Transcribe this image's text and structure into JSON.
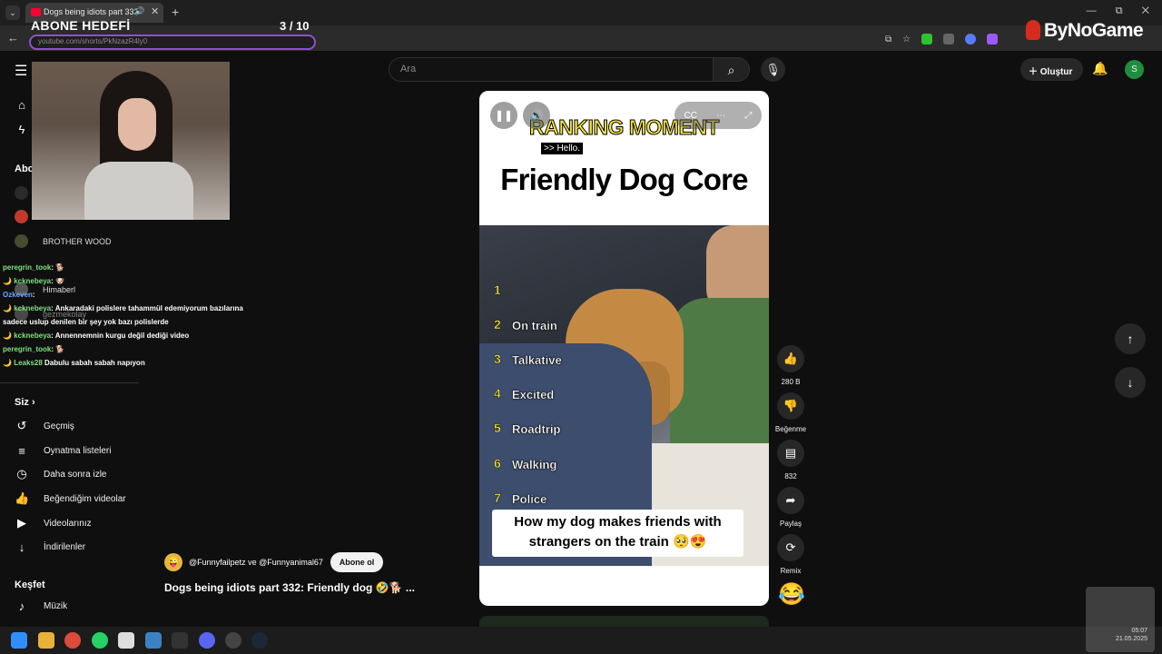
{
  "browser": {
    "tab_title": "Dogs being idiots part 332: Friendly dog",
    "url": "youtube.com/shorts/PkNzazR4ly0",
    "new_tab": "+",
    "tablist": "⌄",
    "back": "←",
    "window_controls": "— ⧉ ✕"
  },
  "stream_overlay": {
    "goal_label": "ABONE HEDEFİ",
    "goal_count": "3  / 10",
    "sponsor": "ByNoGame"
  },
  "header": {
    "search_placeholder": "Ara",
    "create_label": "Oluştur",
    "avatar_letter": "S"
  },
  "sidebar": {
    "subscriptions_heading": "Abo",
    "channels": [
      {
        "name": "BROTHER WOOD"
      },
      {
        "name": "Himaberl"
      },
      {
        "name": "gezmekolay"
      }
    ],
    "you_heading": "Siz",
    "you_items": [
      {
        "label": "Geçmiş",
        "icon": "history-icon"
      },
      {
        "label": "Oynatma listeleri",
        "icon": "playlists-icon"
      },
      {
        "label": "Daha sonra izle",
        "icon": "watch-later-icon"
      },
      {
        "label": "Beğendiğim videolar",
        "icon": "liked-icon"
      },
      {
        "label": "Videolarınız",
        "icon": "your-videos-icon"
      },
      {
        "label": "İndirilenler",
        "icon": "downloads-icon"
      }
    ],
    "explore_heading": "Keşfet",
    "explore_items": [
      {
        "label": "Müzik",
        "icon": "music-icon"
      }
    ]
  },
  "chat": [
    {
      "user": "peregrin_took",
      "text": ": 🐕",
      "color": "#7fe07f"
    },
    {
      "user": "kcknebeya",
      "text": ": 🐶",
      "color": "#7fe07f"
    },
    {
      "user": "Ozkeven",
      "text": ":",
      "color": "#6aa8ff"
    },
    {
      "user": "kcknebeya",
      "text": ": Ankaradaki polislere tahammül edemiyorum bazılarına",
      "color": "#7fe07f"
    },
    {
      "user": "",
      "text": "sadece uslup denilen bir şey yok bazı polislerde",
      "color": "#7fe07f"
    },
    {
      "user": "kcknebeya",
      "text": ": Annennemnin kurgu değil dediği video",
      "color": "#7fe07f"
    },
    {
      "user": "peregrin_took",
      "text": ": 🐕",
      "color": "#7fe07f"
    },
    {
      "user": "Leaks28",
      "text": "Dabulu sabah sabah napıyon",
      "color": "#7fe07f"
    }
  ],
  "player": {
    "ranking_title": "RANKING MOMENT",
    "hello_caption": ">> Hello.",
    "video_title": "Friendly Dog Core",
    "ranks": [
      {
        "num": "1",
        "label": ""
      },
      {
        "num": "2",
        "label": "On train"
      },
      {
        "num": "3",
        "label": "Talkative"
      },
      {
        "num": "4",
        "label": "Excited"
      },
      {
        "num": "5",
        "label": "Roadtrip"
      },
      {
        "num": "6",
        "label": "Walking"
      },
      {
        "num": "7",
        "label": "Police"
      }
    ],
    "caption_line1": "How my dog makes friends with",
    "caption_line2": "strangers on the train 🥺😍",
    "cc_label": "CC"
  },
  "actions": {
    "like_count": "280 B",
    "dislike_label": "Beğenme",
    "comment_count": "832",
    "share_label": "Paylaş",
    "remix_label": "Remix"
  },
  "short_meta": {
    "channels": "@Funnyfailpetz ve @Funnyanimal67",
    "subscribe_label": "Abone ol",
    "title": "Dogs being idiots part 332: Friendly dog 🤣🐕 ..."
  },
  "taskbar": {
    "time": "05:07",
    "date": "21.05.2025"
  }
}
